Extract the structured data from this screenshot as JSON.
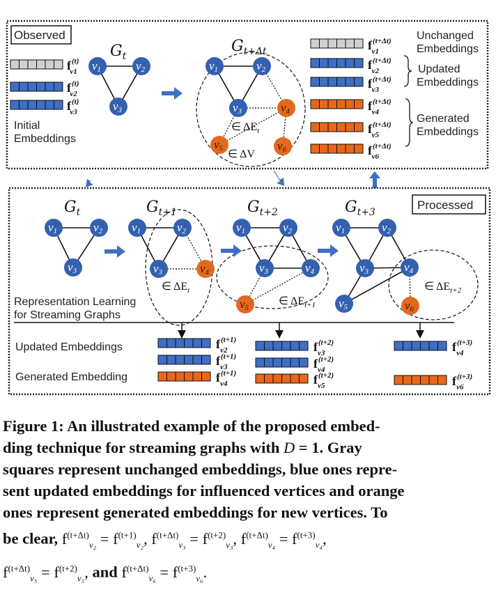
{
  "figure": {
    "observed_label": "Observed",
    "processed_label": "Processed",
    "initial_embeddings_label": [
      "Initial",
      "Embeddings"
    ],
    "unchanged_label": [
      "Unchanged",
      "Embeddings"
    ],
    "updated_label": [
      "Updated",
      "Embeddings"
    ],
    "generated_label": [
      "Generated",
      "Embeddings"
    ],
    "repr_learning_label": [
      "Representation Learning",
      "for Streaming Graphs"
    ],
    "updated_embeddings_row": "Updated Embeddings",
    "generated_embedding_row": "Generated Embedding",
    "graphs": {
      "g_t": "G",
      "g_t_sub": "t",
      "g_tdt_sub": "t+Δt",
      "g_t1_sub": "t+1",
      "g_t2_sub": "t+2",
      "g_t3_sub": "t+3"
    },
    "annotations": {
      "delta_e": "∈ ΔE",
      "delta_e_t": "t",
      "delta_e_t1": "t+1",
      "delta_e_t2": "t+2",
      "delta_v": "∈ ΔV"
    },
    "colors": {
      "gray": "#d0d0d0",
      "blue": "#3e6fc4",
      "orange": "#e8671a",
      "node_blue": "#3460b0",
      "node_orange": "#e2691e",
      "arrow": "#3e6fc4"
    },
    "embedding_cells": 6
  },
  "caption": {
    "line1": "Figure 1: An illustrated example of the proposed embed-",
    "line2a": "ding technique for streaming graphs with ",
    "line2_var": "D",
    "line2b": " = 1. Gray",
    "line3": "squares represent unchanged embeddings, blue ones repre-",
    "line4": "sent updated embeddings for influenced vertices and orange",
    "line5": "ones represent generated embeddings for new vertices. To",
    "line6_prefix": "be clear,",
    "final_word": "and"
  }
}
